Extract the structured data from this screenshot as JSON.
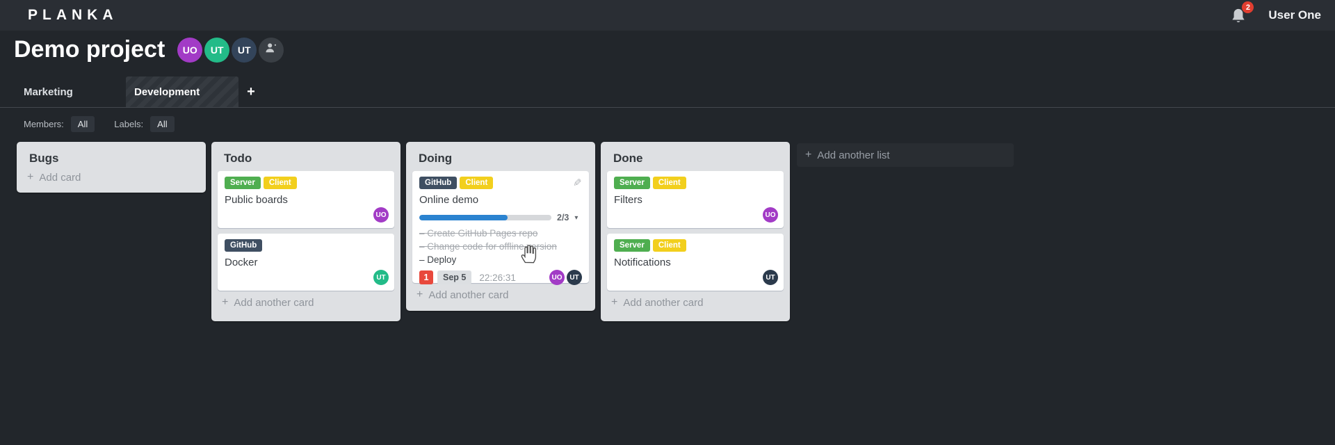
{
  "topbar": {
    "logo": "PLANKA",
    "notifications_count": "2",
    "user_name": "User One"
  },
  "project": {
    "title": "Demo project",
    "members": [
      {
        "initials": "UO",
        "color": "#a23bc6"
      },
      {
        "initials": "UT",
        "color": "#23bb88"
      },
      {
        "initials": "UT",
        "color": "#33445a"
      }
    ]
  },
  "tabs": {
    "items": [
      {
        "label": "Marketing",
        "active": false
      },
      {
        "label": "Development",
        "active": true
      }
    ],
    "add_button": "+"
  },
  "filters": {
    "members_label": "Members:",
    "members_value": "All",
    "labels_label": "Labels:",
    "labels_value": "All"
  },
  "board": {
    "add_list_label": "Add another list",
    "lists": [
      {
        "title": "Bugs",
        "add_card_label": "Add card",
        "cards": []
      },
      {
        "title": "Todo",
        "add_card_label": "Add another card",
        "cards": [
          {
            "name": "Public boards",
            "labels": [
              {
                "text": "Server",
                "color": "#4fae50"
              },
              {
                "text": "Client",
                "color": "#f2cf1d"
              }
            ],
            "member": {
              "initials": "UO",
              "color": "#a23bc6"
            }
          },
          {
            "name": "Docker",
            "labels": [
              {
                "text": "GitHub",
                "color": "#3f4f62"
              }
            ],
            "member": {
              "initials": "UT",
              "color": "#23bb88"
            }
          }
        ]
      },
      {
        "title": "Doing",
        "add_card_label": "Add another card",
        "cards": [
          {
            "name": "Online demo",
            "labels": [
              {
                "text": "GitHub",
                "color": "#3f4f62"
              },
              {
                "text": "Client",
                "color": "#f2cf1d"
              }
            ],
            "progress": {
              "completed": 2,
              "total": 3,
              "label": "2/3",
              "percent": "66.7%",
              "color": "#2b83d0"
            },
            "tasks": [
              {
                "text": "Create GitHub Pages repo",
                "done": true
              },
              {
                "text": "Change code for offline version",
                "done": true
              },
              {
                "text": "Deploy",
                "done": false
              }
            ],
            "notification_count": "1",
            "due_date": "Sep 5",
            "timer": "22:26:31",
            "members": [
              {
                "initials": "UO",
                "color": "#a23bc6"
              },
              {
                "initials": "UT",
                "color": "#2b3a4c"
              }
            ]
          }
        ]
      },
      {
        "title": "Done",
        "add_card_label": "Add another card",
        "cards": [
          {
            "name": "Filters",
            "labels": [
              {
                "text": "Server",
                "color": "#4fae50"
              },
              {
                "text": "Client",
                "color": "#f2cf1d"
              }
            ],
            "member": {
              "initials": "UO",
              "color": "#a23bc6"
            }
          },
          {
            "name": "Notifications",
            "labels": [
              {
                "text": "Server",
                "color": "#4fae50"
              },
              {
                "text": "Client",
                "color": "#f2cf1d"
              }
            ],
            "member": {
              "initials": "UT",
              "color": "#2b3a4c"
            }
          }
        ]
      }
    ]
  }
}
